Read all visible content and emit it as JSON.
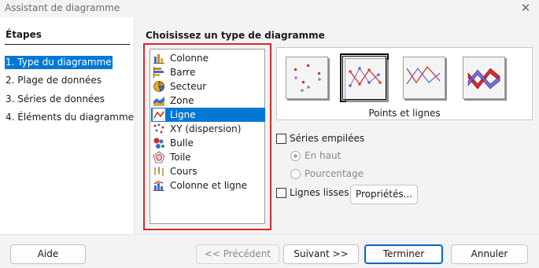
{
  "window": {
    "title": "Assistant de diagramme",
    "close_symbol": "✕"
  },
  "steps": {
    "heading": "Étapes",
    "items": [
      {
        "label": "1. Type du diagramme",
        "selected": true
      },
      {
        "label": "2. Plage de données",
        "selected": false
      },
      {
        "label": "3. Séries de données",
        "selected": false
      },
      {
        "label": "4. Éléments du diagramme",
        "selected": false
      }
    ]
  },
  "chart_type": {
    "heading": "Choisissez un type de diagramme",
    "items": [
      {
        "label": "Colonne",
        "icon": "column-chart-icon"
      },
      {
        "label": "Barre",
        "icon": "bar-chart-icon"
      },
      {
        "label": "Secteur",
        "icon": "pie-chart-icon"
      },
      {
        "label": "Zone",
        "icon": "area-chart-icon"
      },
      {
        "label": "Ligne",
        "icon": "line-chart-icon",
        "selected": true
      },
      {
        "label": "XY (dispersion)",
        "icon": "scatter-chart-icon"
      },
      {
        "label": "Bulle",
        "icon": "bubble-chart-icon"
      },
      {
        "label": "Toile",
        "icon": "net-chart-icon"
      },
      {
        "label": "Cours",
        "icon": "stock-chart-icon"
      },
      {
        "label": "Colonne et ligne",
        "icon": "column-line-chart-icon"
      }
    ],
    "highlight_color": "#d62a2a"
  },
  "variants": {
    "items": [
      {
        "name": "points-only-variant-icon"
      },
      {
        "name": "points-and-lines-variant-icon",
        "selected": true
      },
      {
        "name": "lines-only-variant-icon"
      },
      {
        "name": "3d-lines-variant-icon"
      }
    ],
    "caption": "Points et lignes"
  },
  "options": {
    "stacked_series": "Séries empilées",
    "on_top": "En haut",
    "percent": "Pourcentage",
    "smooth_lines": "Lignes lisses",
    "properties_button": "Propriétés..."
  },
  "buttons": {
    "help": "Aide",
    "previous": "<< Précédent",
    "next": "Suivant >>",
    "finish": "Terminer",
    "cancel": "Annuler"
  },
  "colors": {
    "accent": "#0078d4",
    "selection_text": "#ffffff"
  }
}
